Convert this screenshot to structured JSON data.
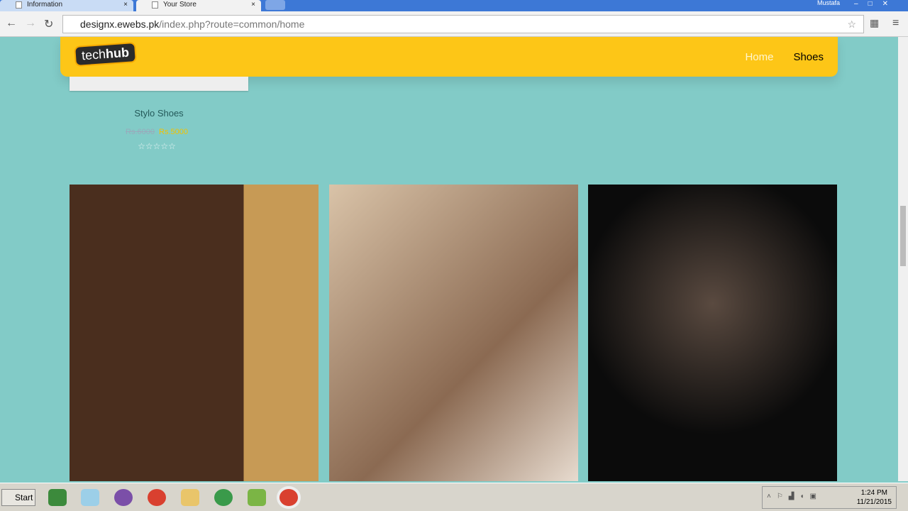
{
  "browser": {
    "tabs": [
      {
        "label": "Information",
        "close": "×"
      },
      {
        "label": "Your Store",
        "close": "×"
      }
    ],
    "user": "Mustafa",
    "url_host": "designx.ewebs.pk",
    "url_path": "/index.php?route=common/home"
  },
  "site": {
    "logo_a": "tech",
    "logo_b": "hub",
    "menu": [
      "Home",
      "Shoes"
    ]
  },
  "product": {
    "name": "Stylo Shoes",
    "old_price": "Rs.6000",
    "new_price": "Rs.5000",
    "stars": "☆☆☆☆☆"
  },
  "taskbar": {
    "start": "Start",
    "time": "1:24 PM",
    "date": "11/21/2015"
  },
  "colors": {
    "header": "#fdc617",
    "background": "#82cbc7"
  }
}
